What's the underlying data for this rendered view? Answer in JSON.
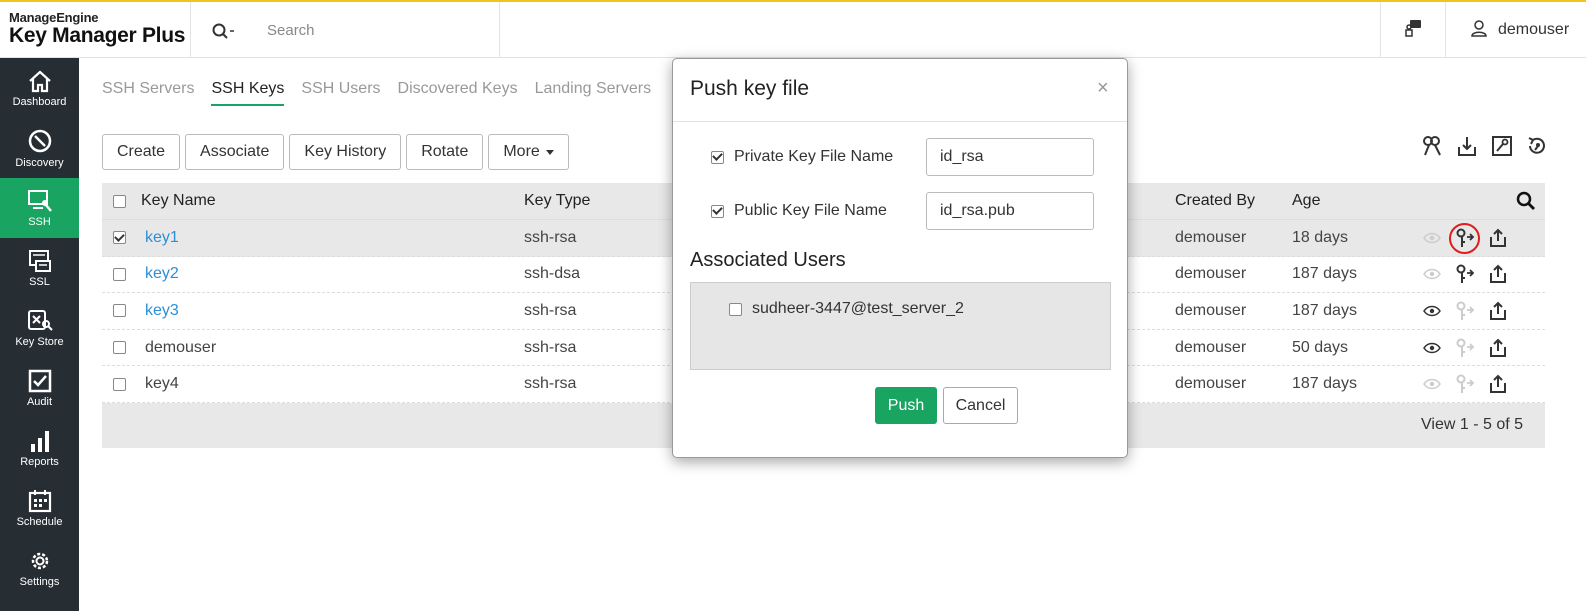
{
  "header": {
    "brand_top": "ManageEngine",
    "brand_product": "Key Manager Plus",
    "search_placeholder": "Search",
    "username": "demouser"
  },
  "sidebar": {
    "items": [
      {
        "label": "Dashboard",
        "icon": "home-icon"
      },
      {
        "label": "Discovery",
        "icon": "compass-icon"
      },
      {
        "label": "SSH",
        "icon": "ssh-icon",
        "active": true
      },
      {
        "label": "SSL",
        "icon": "certificate-icon"
      },
      {
        "label": "Key Store",
        "icon": "key-store-icon"
      },
      {
        "label": "Audit",
        "icon": "checklist-icon"
      },
      {
        "label": "Reports",
        "icon": "bar-chart-icon"
      },
      {
        "label": "Schedule",
        "icon": "calendar-icon"
      },
      {
        "label": "Settings",
        "icon": "gear-icon"
      }
    ]
  },
  "tabs": [
    {
      "label": "SSH Servers"
    },
    {
      "label": "SSH Keys",
      "active": true
    },
    {
      "label": "SSH Users"
    },
    {
      "label": "Discovered Keys"
    },
    {
      "label": "Landing Servers"
    }
  ],
  "toolbar": {
    "create": "Create",
    "associate": "Associate",
    "key_history": "Key History",
    "rotate": "Rotate",
    "more": "More"
  },
  "table": {
    "columns": {
      "key_name": "Key Name",
      "key_type": "Key Type",
      "created_by": "Created By",
      "age": "Age"
    },
    "rows": [
      {
        "name": "key1",
        "type": "ssh-rsa",
        "created_by": "demouser",
        "age": "18 days",
        "link": true,
        "checked": true
      },
      {
        "name": "key2",
        "type": "ssh-dsa",
        "created_by": "demouser",
        "age": "187 days",
        "link": true,
        "checked": false
      },
      {
        "name": "key3",
        "type": "ssh-rsa",
        "created_by": "demouser",
        "age": "187 days",
        "link": true,
        "checked": false
      },
      {
        "name": "demouser",
        "type": "ssh-rsa",
        "created_by": "demouser",
        "age": "50 days",
        "link": false,
        "checked": false
      },
      {
        "name": "key4",
        "type": "ssh-rsa",
        "created_by": "demouser",
        "age": "187 days",
        "link": false,
        "checked": false
      }
    ],
    "footer": "View 1 - 5 of 5"
  },
  "modal": {
    "title": "Push key file",
    "close": "×",
    "private_label": "Private Key File Name",
    "private_value": "id_rsa",
    "public_label": "Public Key File Name",
    "public_value": "id_rsa.pub",
    "assoc_title": "Associated Users",
    "assoc_user": "sudheer-3447@test_server_2",
    "push": "Push",
    "cancel": "Cancel"
  },
  "colors": {
    "accent": "#1aa461",
    "sidebar_bg": "#262e33",
    "link": "#2c8fd6",
    "highlight_circle": "#e21b1b",
    "top_border": "#f0c419"
  }
}
